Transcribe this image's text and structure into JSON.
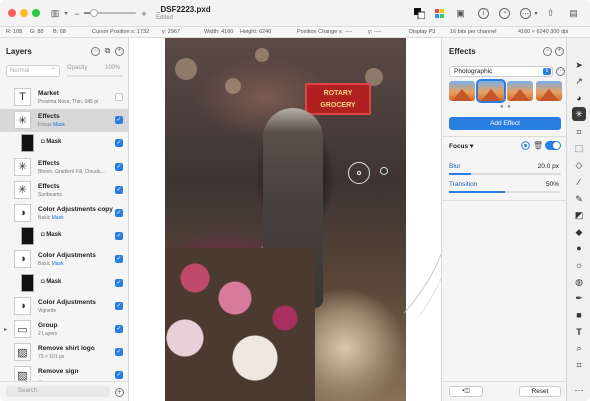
{
  "titlebar": {
    "doc_title": "_DSF2223.pxd",
    "doc_subtitle": "Edited",
    "zoom_minus": "−",
    "zoom_plus": "+",
    "zoom_level": 0.2
  },
  "infobar": {
    "r": "R: 108",
    "g": "G: 88",
    "b": "B: 68",
    "cursor_x": "Cursor Position x: 1732",
    "cursor_y": "y: 2967",
    "width": "Width: 4160",
    "height": "Height: 6240",
    "pos_change_x": "Position Change x: ----",
    "pos_change_y": "y: ----",
    "display": "Display P3",
    "bits": "16 bits per channel",
    "size": "4160 × 6240 300 dpi"
  },
  "layers_panel": {
    "title": "Layers",
    "blend_mode": "Normal",
    "opacity_label": "Opacity",
    "opacity_value": "100%",
    "search_placeholder": "Search",
    "items": [
      {
        "name": "Market",
        "sub": "Proxima Nova, Thin, 945 pt",
        "icon": "T",
        "kind": "text",
        "checked": false
      },
      {
        "name": "Effects",
        "sub": "Focus",
        "mask_link": "Mask",
        "icon": "✳",
        "kind": "effects",
        "checked": true,
        "selected": true
      },
      {
        "name": "Mask",
        "kind": "mask",
        "checked": true
      },
      {
        "name": "Effects",
        "sub": "Bloom, Gradient Fill, Clouds,...",
        "icon": "✳",
        "kind": "effects",
        "checked": true
      },
      {
        "name": "Effects",
        "sub": "Sunbeams",
        "icon": "✳",
        "kind": "effects",
        "checked": true
      },
      {
        "name": "Color Adjustments copy",
        "sub": "Basic",
        "mask_link": "Mask",
        "icon": "◑",
        "kind": "adjust",
        "checked": true
      },
      {
        "name": "Mask",
        "kind": "mask",
        "checked": true
      },
      {
        "name": "Color Adjustments",
        "sub": "Basic",
        "mask_link": "Mask",
        "icon": "◑",
        "kind": "adjust",
        "checked": true
      },
      {
        "name": "Mask",
        "kind": "mask",
        "checked": true
      },
      {
        "name": "Color Adjustments",
        "sub": "Vignette",
        "icon": "◑",
        "kind": "adjust",
        "checked": true
      },
      {
        "name": "Group",
        "sub": "2 Layers",
        "icon": "▭",
        "kind": "group",
        "checked": true
      },
      {
        "name": "Remove shirt logo",
        "sub": "73 × 101 px",
        "icon": "▨",
        "kind": "image",
        "checked": true
      },
      {
        "name": "Remove sign",
        "sub": "...",
        "icon": "▨",
        "kind": "image",
        "checked": true
      }
    ]
  },
  "canvas": {
    "sign_line1": "ROTARY",
    "sign_line2": "GROCERY"
  },
  "effects_panel": {
    "title": "Effects",
    "category": "Photographic",
    "add_button": "Add Effect",
    "focus_title": "Focus",
    "params": [
      {
        "label": "Blur",
        "value": "20.0 px",
        "fraction": 0.2
      },
      {
        "label": "Transition",
        "value": "50%",
        "fraction": 0.5
      }
    ],
    "reset_label": "Reset"
  },
  "colors": {
    "accent": "#2a7de1",
    "selection": "#d8d8d8"
  }
}
